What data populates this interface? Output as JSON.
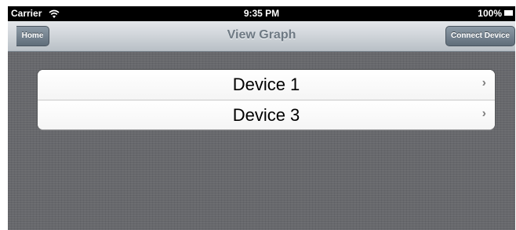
{
  "status_bar": {
    "carrier": "Carrier",
    "wifi_icon": "wifi-icon",
    "time": "9:35 PM",
    "battery_percent": "100%",
    "battery_icon": "battery-icon"
  },
  "nav_bar": {
    "title": "View Graph",
    "back_label": "Home",
    "action_label": "Connect Device"
  },
  "devices": {
    "items": [
      {
        "label": "Device 1",
        "icon": "chevron-right-icon"
      },
      {
        "label": "Device 3",
        "icon": "chevron-right-icon"
      }
    ]
  },
  "colors": {
    "nav_title": "#6e7983",
    "button": "#6f7c89",
    "background": "#67686c"
  }
}
